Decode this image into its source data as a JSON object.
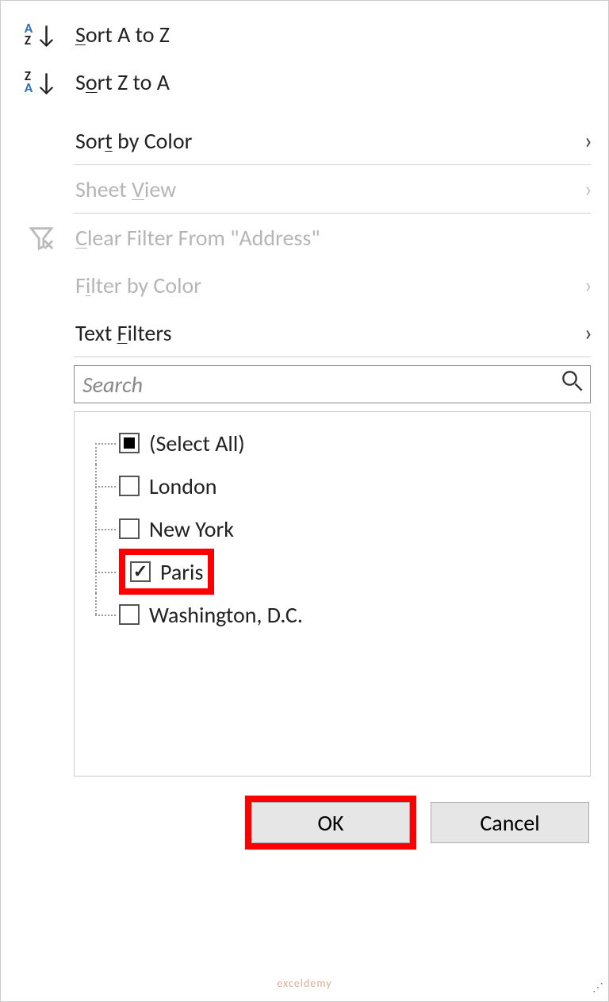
{
  "sort": {
    "az_label": "Sort A to Z",
    "za_label": "Sort Z to A",
    "by_color_label": "Sort by Color"
  },
  "sheet_view_label": "Sheet View",
  "clear_filter_label": "Clear Filter From \"Address\"",
  "filter_by_color_label": "Filter by Color",
  "text_filters_label": "Text Filters",
  "search": {
    "placeholder": "Search"
  },
  "filter_items": {
    "select_all": {
      "label": "(Select All)",
      "state": "indeterminate"
    },
    "item1": {
      "label": "London",
      "state": "unchecked"
    },
    "item2": {
      "label": "New York",
      "state": "unchecked"
    },
    "item3": {
      "label": "Paris",
      "state": "checked"
    },
    "item4": {
      "label": "Washington, D.C.",
      "state": "unchecked"
    }
  },
  "buttons": {
    "ok": "OK",
    "cancel": "Cancel"
  },
  "watermark": "exceldemy"
}
